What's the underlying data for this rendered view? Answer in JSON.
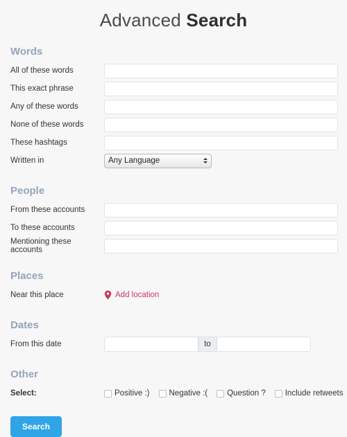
{
  "header": {
    "title_light": "Advanced",
    "title_bold": "Search"
  },
  "sections": {
    "words": {
      "heading": "Words",
      "rows": [
        {
          "label": "All of these words",
          "value": "",
          "placeholder": ""
        },
        {
          "label": "This exact phrase",
          "value": "",
          "placeholder": ""
        },
        {
          "label": "Any of these words",
          "value": "",
          "placeholder": ""
        },
        {
          "label": "None of these words",
          "value": "",
          "placeholder": ""
        },
        {
          "label": "These hashtags",
          "value": "",
          "placeholder": ""
        }
      ],
      "language_row": {
        "label": "Written in",
        "selected": "Any Language",
        "options": [
          "Any Language"
        ]
      }
    },
    "people": {
      "heading": "People",
      "rows": [
        {
          "label": "From these accounts",
          "value": "",
          "placeholder": ""
        },
        {
          "label": "To these accounts",
          "value": "",
          "placeholder": ""
        },
        {
          "label": "Mentioning these accounts",
          "value": "",
          "placeholder": ""
        }
      ]
    },
    "places": {
      "heading": "Places",
      "label": "Near this place",
      "add_location_label": "Add location",
      "add_location_icon": "map-pin-icon",
      "accent_color": "#c8395a"
    },
    "dates": {
      "heading": "Dates",
      "label": "From this date",
      "from_value": "",
      "separator_label": "to",
      "to_value": ""
    },
    "other": {
      "heading": "Other",
      "label": "Select:",
      "checkboxes": [
        {
          "label": "Positive :)",
          "checked": false
        },
        {
          "label": "Negative :(",
          "checked": false
        },
        {
          "label": "Question ?",
          "checked": false
        },
        {
          "label": "Include retweets",
          "checked": false
        }
      ]
    }
  },
  "actions": {
    "search_label": "Search",
    "search_color": "#2fa4e7"
  }
}
